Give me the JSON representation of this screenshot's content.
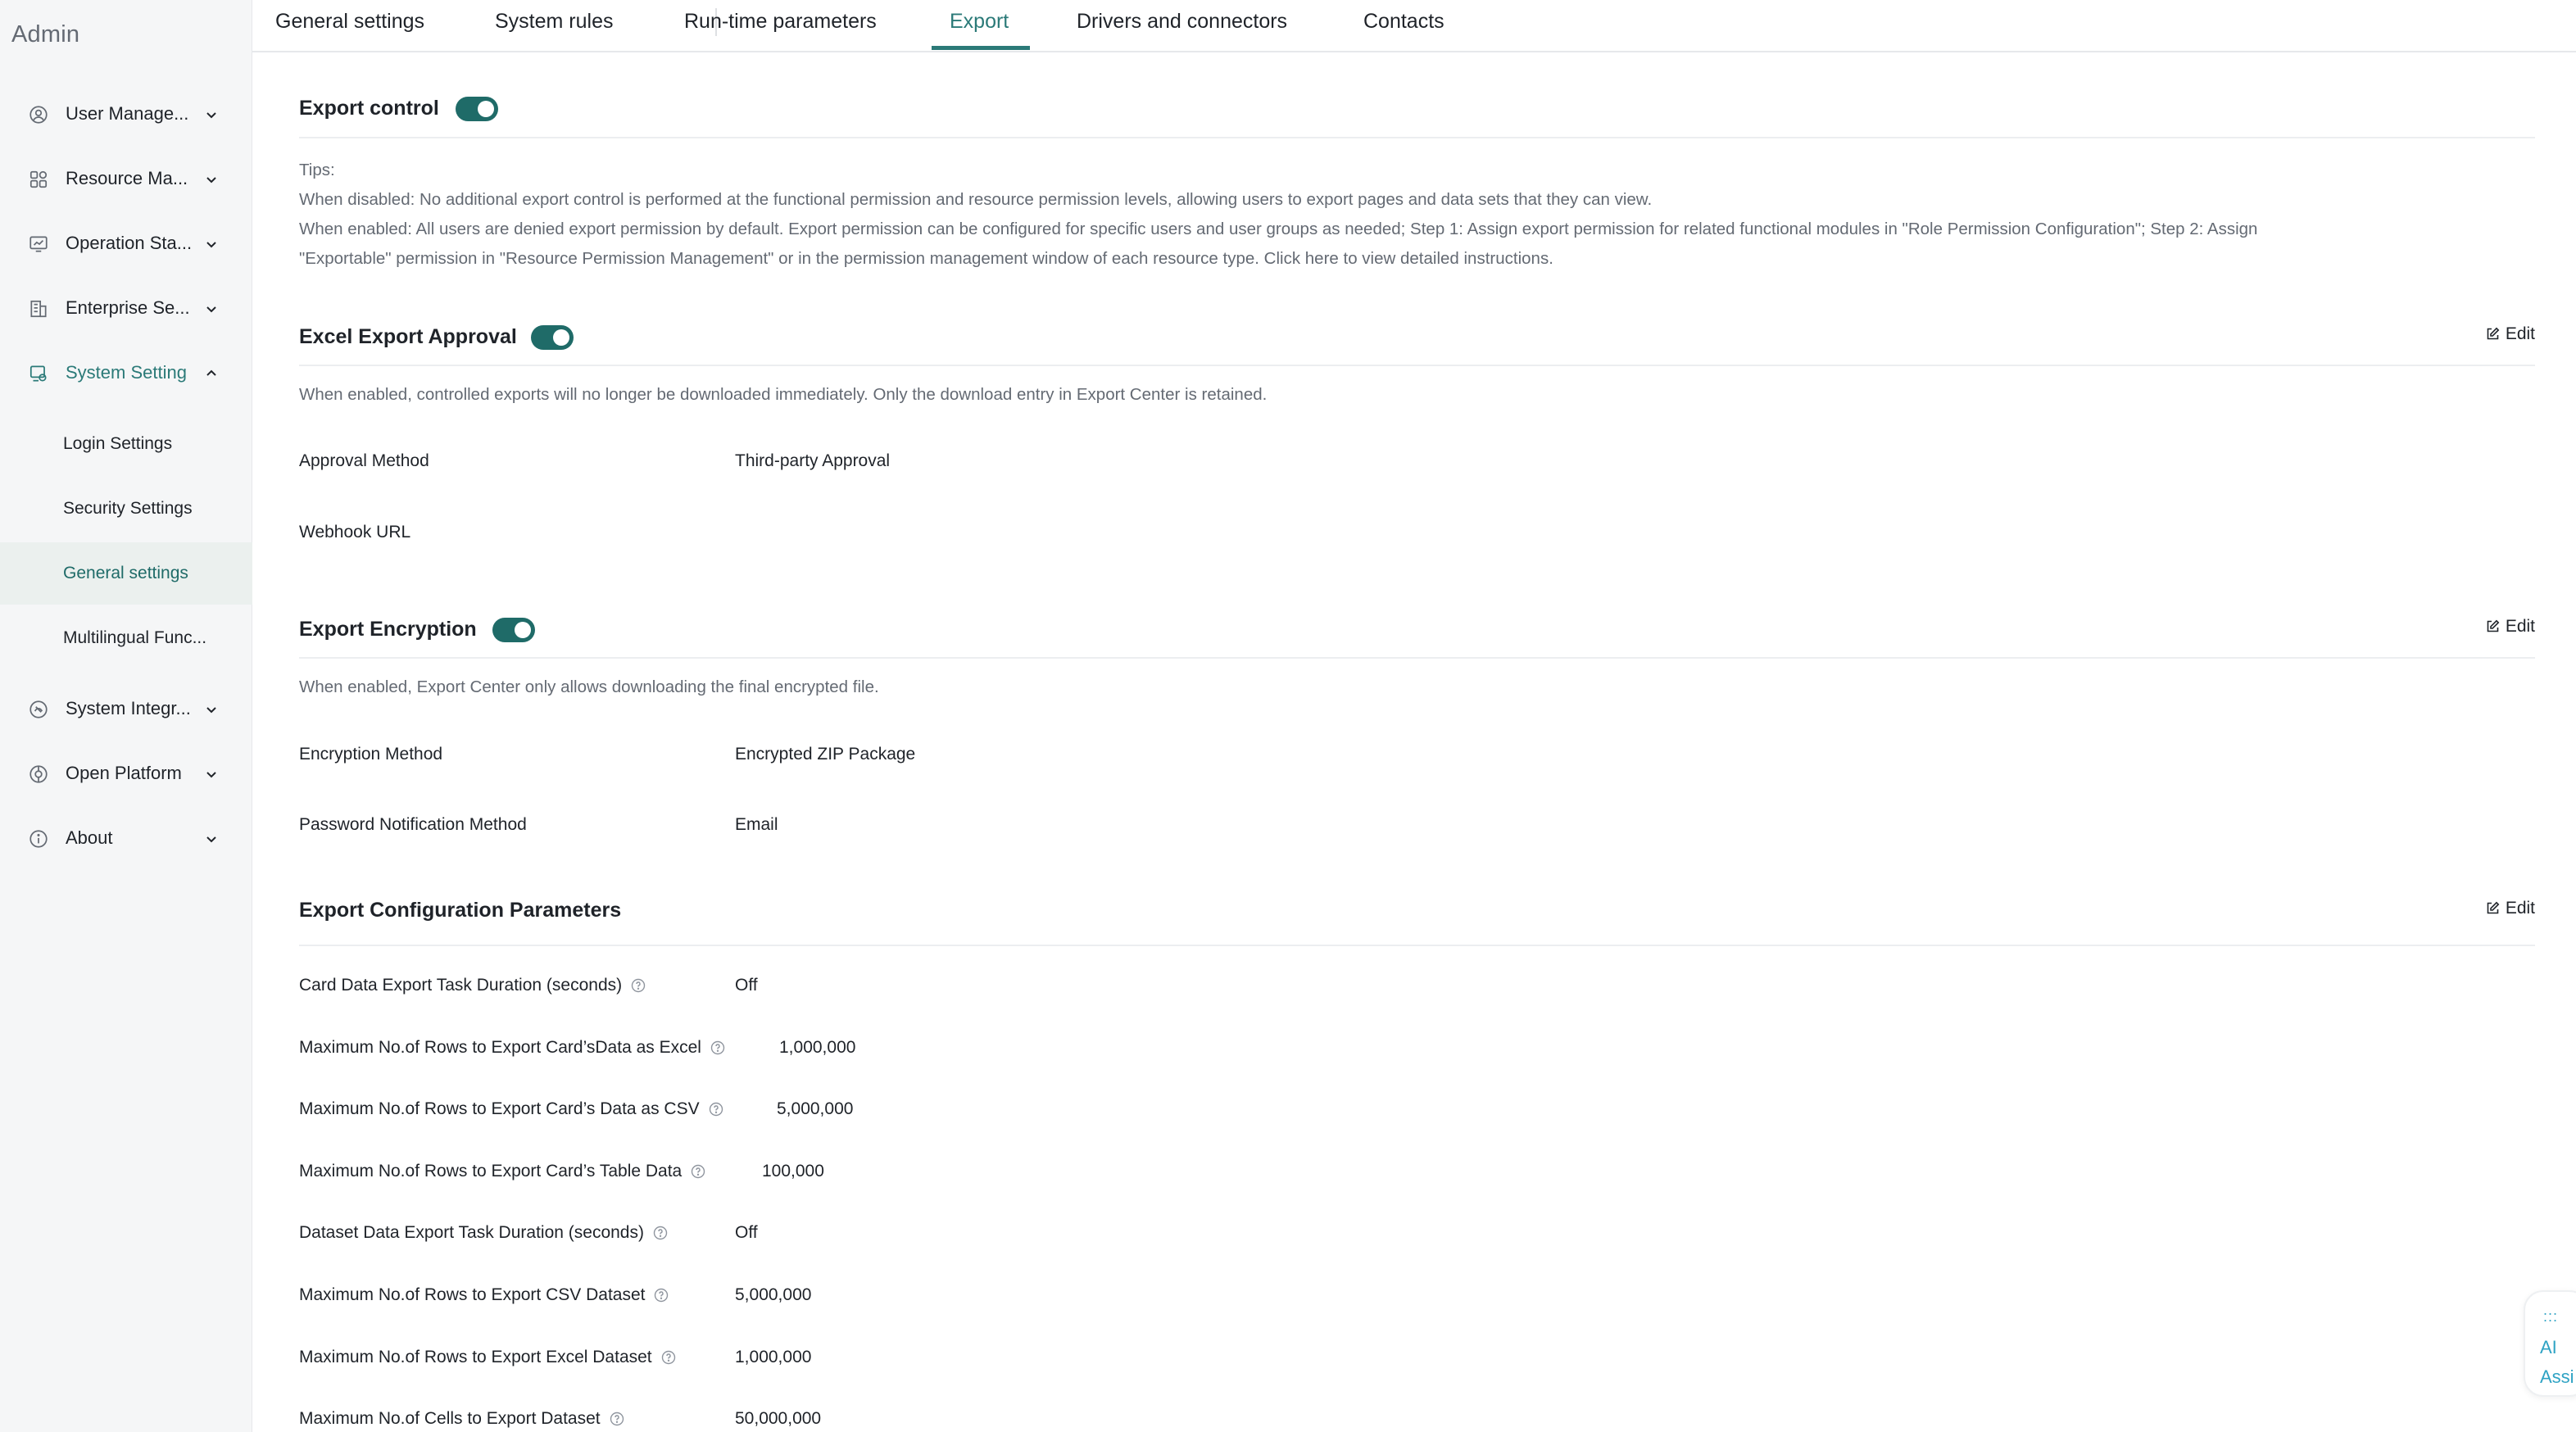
{
  "sidebar": {
    "brand": "Admin",
    "items": [
      {
        "label": "User Manage...",
        "icon": "user-circle-icon",
        "expanded": false
      },
      {
        "label": "Resource Ma...",
        "icon": "grid-icon",
        "expanded": false
      },
      {
        "label": "Operation Sta...",
        "icon": "monitor-chart-icon",
        "expanded": false
      },
      {
        "label": "Enterprise Se...",
        "icon": "building-icon",
        "expanded": false
      },
      {
        "label": "System Setting",
        "icon": "settings-shield-icon",
        "expanded": true
      },
      {
        "label": "System Integr...",
        "icon": "integration-icon",
        "expanded": false
      },
      {
        "label": "Open Platform",
        "icon": "platform-icon",
        "expanded": false
      },
      {
        "label": "About",
        "icon": "info-icon",
        "expanded": false
      }
    ],
    "sub_items": [
      {
        "label": "Login Settings"
      },
      {
        "label": "Security Settings"
      },
      {
        "label": "General settings",
        "selected": true
      },
      {
        "label": "Multilingual Func..."
      }
    ]
  },
  "tabs": [
    {
      "label": "General settings"
    },
    {
      "label": "System rules"
    },
    {
      "label": "Run-time parameters"
    },
    {
      "label": "Export",
      "active": true
    },
    {
      "label": "Drivers and connectors"
    },
    {
      "label": "Contacts"
    }
  ],
  "export_control": {
    "title": "Export control",
    "enabled": true,
    "tips_heading": "Tips:",
    "tip_1": "When disabled: No additional export control is performed at the functional permission and resource permission levels, allowing users to export pages and data sets that they can view.",
    "tip_2_line_1": "When enabled: All users are denied export permission by default. Export permission can be configured for specific users and user groups as needed; Step 1: Assign export permission for related functional modules in \"Role Permission Configuration\"; Step 2: Assign",
    "tip_2_line_2": "\"Exportable\" permission in \"Resource Permission Management\" or in the permission management window of each resource type. Click here to view detailed instructions."
  },
  "excel_export_approval": {
    "title": "Excel Export Approval",
    "enabled": true,
    "edit_label": "Edit",
    "description": "When enabled, controlled exports will no longer be downloaded immediately. Only the download entry in Export Center is retained.",
    "approval_method_label": "Approval Method",
    "approval_method_value": "Third-party Approval",
    "webhook_label": "Webhook URL",
    "webhook_value": ""
  },
  "export_encryption": {
    "title": "Export Encryption",
    "enabled": true,
    "edit_label": "Edit",
    "description": "When enabled, Export Center only allows downloading the final encrypted file.",
    "encryption_method_label": "Encryption Method",
    "encryption_method_value": "Encrypted ZIP Package",
    "password_notification_label": "Password Notification Method",
    "password_notification_value": "Email"
  },
  "export_config": {
    "title": "Export Configuration Parameters",
    "edit_label": "Edit",
    "params": [
      {
        "label": "Card Data Export Task Duration (seconds)",
        "value": "Off"
      },
      {
        "label": "Maximum No.of Rows to Export Card’sData as Excel",
        "value": "1,000,000"
      },
      {
        "label": "Maximum No.of Rows to Export Card’s Data as CSV",
        "value": "5,000,000"
      },
      {
        "label": "Maximum No.of Rows to Export Card’s Table Data",
        "value": "100,000"
      },
      {
        "label": "Dataset Data Export Task Duration (seconds)",
        "value": "Off"
      },
      {
        "label": "Maximum No.of Rows to Export CSV Dataset",
        "value": "5,000,000"
      },
      {
        "label": "Maximum No.of Rows to Export Excel Dataset",
        "value": "1,000,000"
      },
      {
        "label": "Maximum No.of Cells to Export Dataset",
        "value": "50,000,000"
      }
    ]
  },
  "ai_assistant": {
    "dots": ":::",
    "line1": "AI",
    "line2": "Assi"
  },
  "colors": {
    "accent": "#1f6b68",
    "accent_text": "#2b7a78",
    "muted": "#646a73",
    "sidebar_bg": "#f5f6f7",
    "selected_bg": "#ebf0ee"
  }
}
